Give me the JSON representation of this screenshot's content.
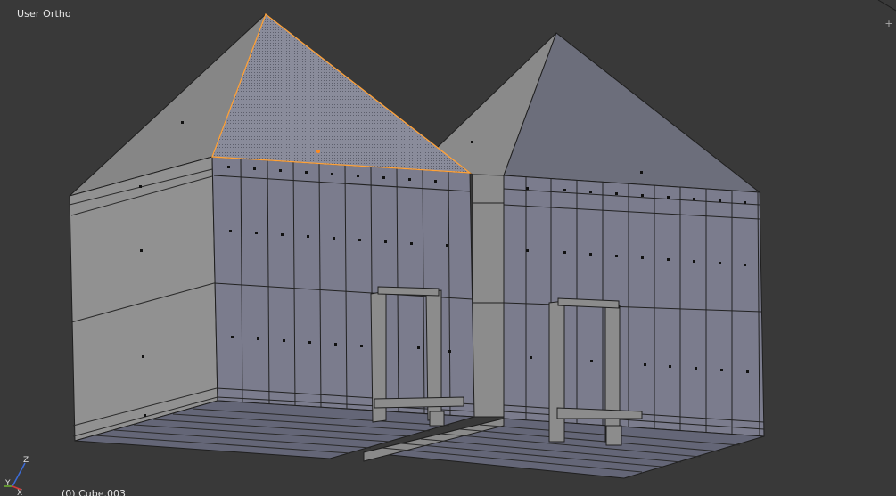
{
  "viewport": {
    "view_name": "User Ortho",
    "object_info": "(0) Cube.003",
    "split_widget_icon": "plus-icon"
  },
  "axes_gizmo": {
    "x_label": "X",
    "y_label": "Y",
    "z_label": "Z"
  },
  "colors": {
    "background": "#393939",
    "wall_front": "#7b7c8d",
    "wall_side": "#8e8e8e",
    "roof_side": "#878787",
    "roof_front": "#6c6e7b",
    "floor": "#646677",
    "wire": "#1f1f1f",
    "selection": "#ffa238",
    "axis_x": "#d43a3a",
    "axis_y": "#6fb32f",
    "axis_z": "#3c6cd9"
  }
}
